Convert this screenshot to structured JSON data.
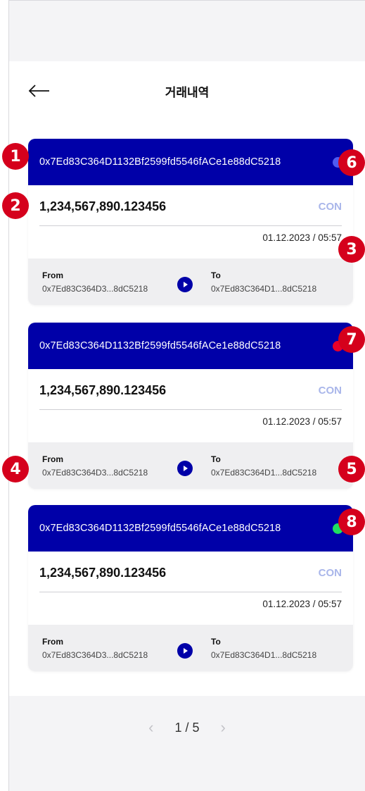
{
  "header": {
    "title": "거래내역",
    "back_icon": "arrow-left-icon"
  },
  "transactions": [
    {
      "address": "0x7Ed83C364D1132Bf2599fd5546fACe1e88dC5218",
      "amount": "1,234,567,890.123456",
      "unit": "CON",
      "datetime": "01.12.2023 / 05:57",
      "from_label": "From",
      "from_address": "0x7Ed83C364D3...8dC5218",
      "to_label": "To",
      "to_address": "0x7Ed83C364D1...8dC5218",
      "status_color": "#4f5bf0"
    },
    {
      "address": "0x7Ed83C364D1132Bf2599fd5546fACe1e88dC5218",
      "amount": "1,234,567,890.123456",
      "unit": "CON",
      "datetime": "01.12.2023 / 05:57",
      "from_label": "From",
      "from_address": "0x7Ed83C364D3...8dC5218",
      "to_label": "To",
      "to_address": "0x7Ed83C364D1...8dC5218",
      "status_color": "#e8002a"
    },
    {
      "address": "0x7Ed83C364D1132Bf2599fd5546fACe1e88dC5218",
      "amount": "1,234,567,890.123456",
      "unit": "CON",
      "datetime": "01.12.2023 / 05:57",
      "from_label": "From",
      "from_address": "0x7Ed83C364D3...8dC5218",
      "to_label": "To",
      "to_address": "0x7Ed83C364D1...8dC5218",
      "status_color": "#1fe060"
    }
  ],
  "annotations": [
    "1",
    "2",
    "3",
    "4",
    "5",
    "6",
    "7",
    "8"
  ],
  "pagination": {
    "current": "1 / 5",
    "prev_icon": "chevron-left-icon",
    "next_icon": "chevron-right-icon"
  },
  "colors": {
    "primary": "#0000a8",
    "badge": "#d5001c",
    "unit": "#a9b6ea"
  }
}
